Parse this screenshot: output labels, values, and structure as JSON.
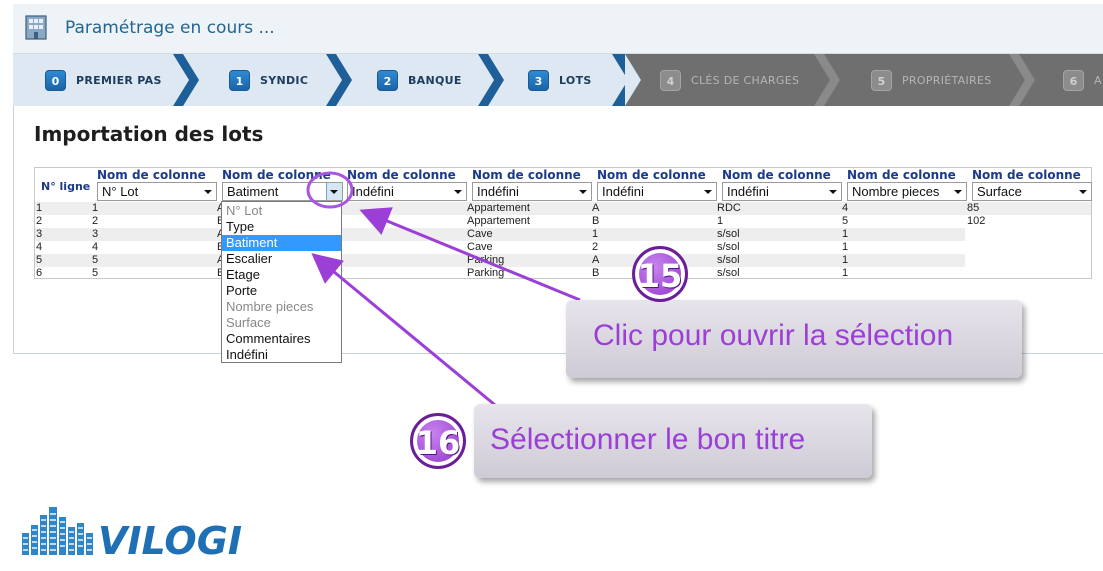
{
  "header": {
    "title": "Paramétrage en cours ..."
  },
  "wizard": {
    "steps": [
      {
        "num": "0",
        "label": "PREMIER PAS",
        "state": "done"
      },
      {
        "num": "1",
        "label": "SYNDIC",
        "state": "done"
      },
      {
        "num": "2",
        "label": "BANQUE",
        "state": "done"
      },
      {
        "num": "3",
        "label": "LOTS",
        "state": "done"
      },
      {
        "num": "4",
        "label": "CLÉS DE CHARGES",
        "state": "todo"
      },
      {
        "num": "5",
        "label": "PROPRIÉTAIRES",
        "state": "todo"
      },
      {
        "num": "6",
        "label": "A",
        "state": "todo"
      }
    ]
  },
  "main": {
    "section_title": "Importation des lots",
    "row_header": "N° ligne",
    "column_header": "Nom de colonne",
    "selects": [
      "N° Lot",
      "Batiment",
      "Indéfini",
      "Indéfini",
      "Indéfini",
      "Indéfini",
      "Nombre pieces",
      "Surface"
    ],
    "rows": [
      {
        "line": "1",
        "c1": "1",
        "c2": "A",
        "c4": "Appartement",
        "c5": "A",
        "c6": "RDC",
        "c7": "4",
        "c8": "85"
      },
      {
        "line": "2",
        "c1": "2",
        "c2": "B",
        "c4": "Appartement",
        "c5": "B",
        "c6": "1",
        "c7": "5",
        "c8": "102"
      },
      {
        "line": "3",
        "c1": "3",
        "c2": "A",
        "c4": "Cave",
        "c5": "1",
        "c6": "s/sol",
        "c7": "1",
        "c8": ""
      },
      {
        "line": "4",
        "c1": "4",
        "c2": "B",
        "c4": "Cave",
        "c5": "2",
        "c6": "s/sol",
        "c7": "1",
        "c8": ""
      },
      {
        "line": "5",
        "c1": "5",
        "c2": "A",
        "c4": "Parking",
        "c5": "A",
        "c6": "s/sol",
        "c7": "1",
        "c8": ""
      },
      {
        "line": "6",
        "c1": "5",
        "c2": "B",
        "c4": "Parking",
        "c5": "B",
        "c6": "s/sol",
        "c7": "1",
        "c8": ""
      }
    ],
    "dropdown_options": [
      {
        "label": "N° Lot",
        "state": "disabled"
      },
      {
        "label": "Type",
        "state": "normal"
      },
      {
        "label": "Batiment",
        "state": "selected"
      },
      {
        "label": "Escalier",
        "state": "normal"
      },
      {
        "label": "Etage",
        "state": "normal"
      },
      {
        "label": "Porte",
        "state": "normal"
      },
      {
        "label": "Nombre pieces",
        "state": "disabled"
      },
      {
        "label": "Surface",
        "state": "disabled"
      },
      {
        "label": "Commentaires",
        "state": "normal"
      },
      {
        "label": "Indéfini",
        "state": "normal"
      }
    ]
  },
  "annotations": {
    "step15_number": "15",
    "step15_text": "Clic pour ouvrir la sélection",
    "step16_number": "16",
    "step16_text": "Sélectionner le bon titre"
  },
  "brand": {
    "name": "VILOGI"
  },
  "colors": {
    "accent_blue": "#1b64a8",
    "annotation_purple": "#9b3fd6",
    "highlight": "#3399ff"
  }
}
